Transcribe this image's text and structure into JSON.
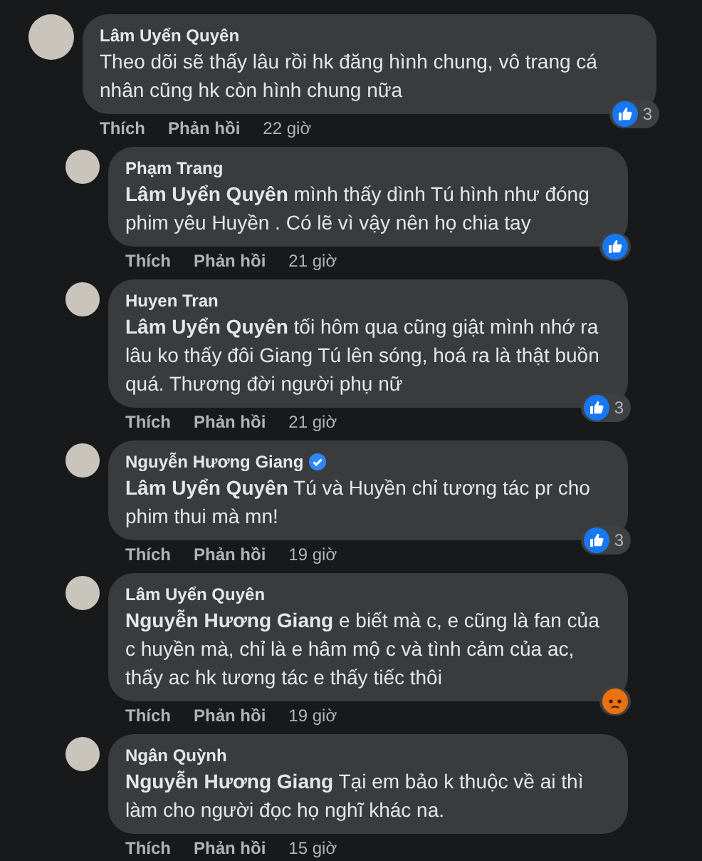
{
  "comments": [
    {
      "author": "Lâm Uyển Quyên",
      "verified": false,
      "text": "Theo dõi sẽ thấy lâu rồi hk đăng hình chung, vô trang cá nhân cũng hk còn hình chung nữa",
      "actions": [
        "Thích",
        "Phản hồi"
      ],
      "time": "22 giờ",
      "reaction": {
        "kind": "like",
        "count": "3"
      },
      "children": [
        {
          "author": "Phạm Trang",
          "verified": false,
          "text": "**Lâm Uyển Quyên** mình thấy dình Tú hình như đóng phim yêu Huyền . Có lẽ vì vậy nên họ chia tay",
          "actions": [
            "Thích",
            "Phản hồi"
          ],
          "time": "21 giờ",
          "reaction": {
            "kind": "like"
          }
        },
        {
          "author": "Huyen Tran",
          "verified": false,
          "text": "**Lâm Uyển Quyên** tối hôm qua cũng giật mình nhớ ra lâu ko thấy đôi Giang Tú lên sóng, hoá ra là thật buồn quá. Thương đời người phụ nữ",
          "actions": [
            "Thích",
            "Phản hồi"
          ],
          "time": "21 giờ",
          "reaction": {
            "kind": "like",
            "count": "3"
          }
        },
        {
          "author": "Nguyễn Hương Giang",
          "verified": true,
          "text": "**Lâm Uyển Quyên** Tú và Huyền chỉ tương tác pr cho phim thui mà mn!",
          "actions": [
            "Thích",
            "Phản hồi"
          ],
          "time": "19 giờ",
          "reaction": {
            "kind": "like",
            "count": "3"
          }
        },
        {
          "author": "Lâm Uyển Quyên",
          "verified": false,
          "text": "**Nguyễn Hương Giang** e biết mà c, e cũng là fan của c huyền mà, chỉ là e hâm mộ c và tình cảm của ac, thấy ac hk tương tác e thấy tiếc thôi",
          "actions": [
            "Thích",
            "Phản hồi"
          ],
          "time": "19 giờ",
          "reaction": {
            "kind": "angry"
          }
        },
        {
          "author": "Ngân Quỳnh",
          "verified": false,
          "text": "**Nguyễn Hương Giang** Tại em bảo k thuộc về ai thì làm cho người đọc họ nghĩ khác na.",
          "actions": [
            "Thích",
            "Phản hồi"
          ],
          "time": "15 giờ"
        }
      ]
    }
  ]
}
